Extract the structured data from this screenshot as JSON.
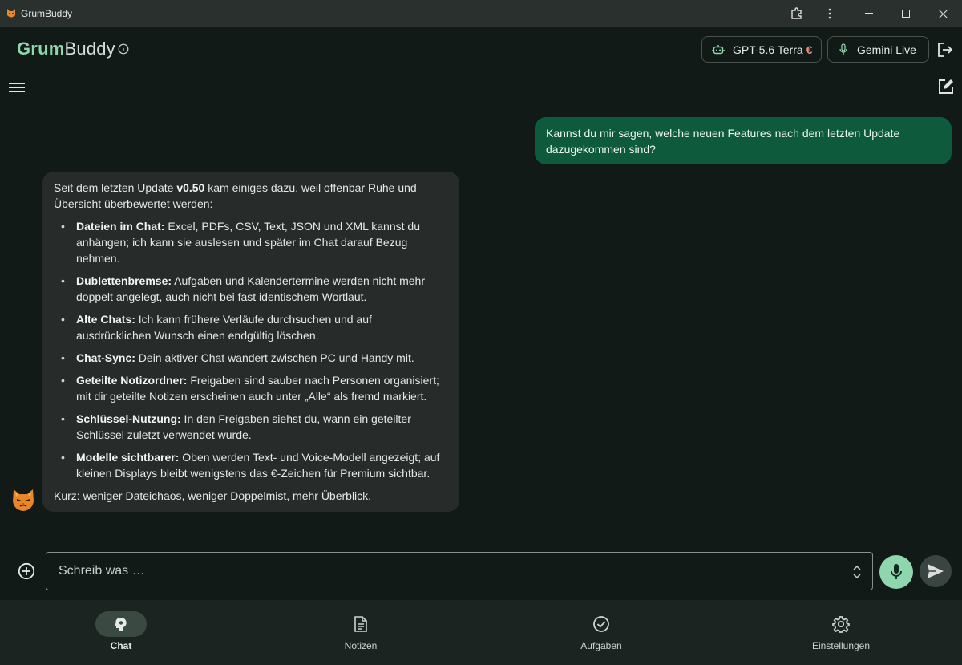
{
  "window": {
    "title": "GrumBuddy"
  },
  "header": {
    "brand_part1": "Grum",
    "brand_part2": "Buddy",
    "text_model_label": "GPT-5.6 Terra",
    "premium_marker": "€",
    "voice_model_label": "Gemini Live"
  },
  "chat": {
    "user_message": "Kannst du mir sagen, welche neuen Features nach dem letzten Update dazugekommen sind?",
    "bot_intro_before": "Seit dem letzten Update ",
    "bot_intro_version": "v0.50",
    "bot_intro_after": " kam einiges dazu, weil offenbar Ruhe und Übersicht überbewertet werden:",
    "features": [
      {
        "title": "Dateien im Chat:",
        "text": " Excel, PDFs, CSV, Text, JSON und XML kannst du anhängen; ich kann sie auslesen und später im Chat darauf Bezug nehmen."
      },
      {
        "title": "Dublettenbremse:",
        "text": " Aufgaben und Kalendertermine werden nicht mehr doppelt angelegt, auch nicht bei fast identischem Wortlaut."
      },
      {
        "title": "Alte Chats:",
        "text": " Ich kann frühere Verläufe durchsuchen und auf ausdrücklichen Wunsch einen endgültig löschen."
      },
      {
        "title": "Chat-Sync:",
        "text": " Dein aktiver Chat wandert zwischen PC und Handy mit."
      },
      {
        "title": "Geteilte Notizordner:",
        "text": " Freigaben sind sauber nach Personen organisiert; mit dir geteilte Notizen erscheinen auch unter „Alle“ als fremd markiert."
      },
      {
        "title": "Schlüssel-Nutzung:",
        "text": " In den Freigaben siehst du, wann ein geteilter Schlüssel zuletzt verwendet wurde."
      },
      {
        "title": "Modelle sichtbarer:",
        "text": " Oben werden Text- und Voice-Modell angezeigt; auf kleinen Displays bleibt wenigstens das €-Zeichen für Premium sichtbar."
      }
    ],
    "bot_summary": "Kurz: weniger Dateichaos, weniger Doppelmist, mehr Überblick."
  },
  "composer": {
    "placeholder": "Schreib was …"
  },
  "nav": {
    "items": [
      {
        "label": "Chat",
        "icon": "brain-icon",
        "active": true
      },
      {
        "label": "Notizen",
        "icon": "document-icon",
        "active": false
      },
      {
        "label": "Aufgaben",
        "icon": "check-circle-icon",
        "active": false
      },
      {
        "label": "Einstellungen",
        "icon": "gear-icon",
        "active": false
      }
    ]
  },
  "colors": {
    "accent": "#8fd6ae",
    "user_bubble": "#0d5a3d",
    "bot_bubble": "#272c2a",
    "background": "#111a16",
    "premium": "#f08a7a"
  }
}
